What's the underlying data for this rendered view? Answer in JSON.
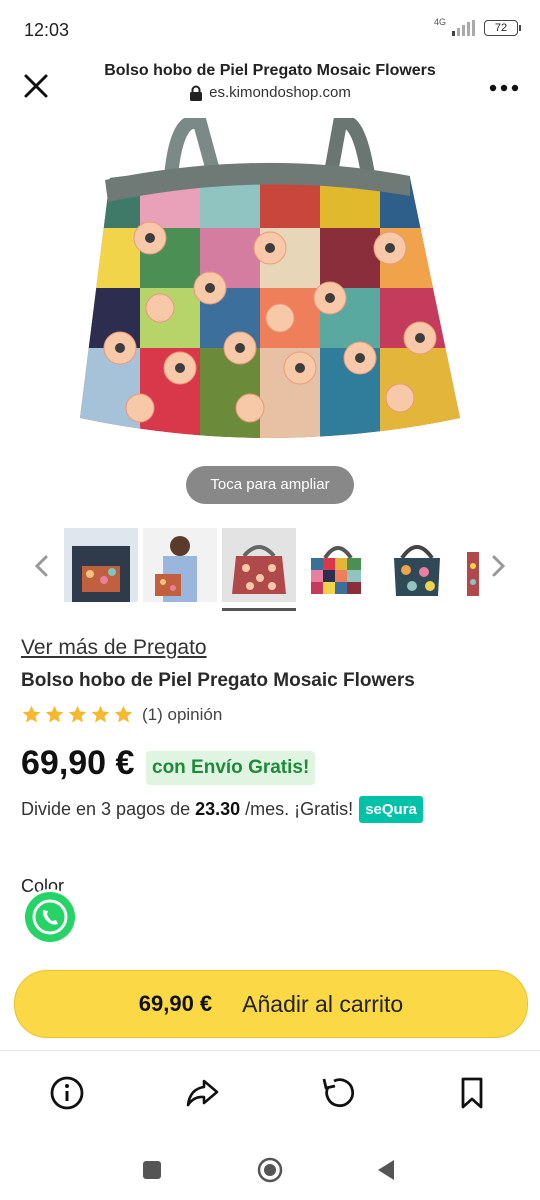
{
  "status": {
    "time": "12:03",
    "network": "4G",
    "battery": "72"
  },
  "topbar": {
    "title": "Bolso hobo de Piel Pregato Mosaic Flowers",
    "domain": "es.kimondoshop.com"
  },
  "hero": {
    "zoom_hint": "Toca para ampliar"
  },
  "product": {
    "brand_link": "Ver más de Pregato",
    "name": "Bolso hobo de Piel Pregato Mosaic Flowers",
    "rating_text": "(1) opinión",
    "rating_stars": 5,
    "price": "69,90 €",
    "free_shipping": "con Envío Gratis!",
    "installments_prefix": "Divide en 3 pagos de",
    "installments_amount": "23.30",
    "installments_suffix": "/mes. ¡Gratis!",
    "sequra_badge": "seQura",
    "color_label": "Color"
  },
  "cart": {
    "price": "69,90 €",
    "label": "Añadir al carrito"
  },
  "colors": {
    "cart_button": "#fbd946",
    "free_ship_text": "#1e8a3a",
    "sequra": "#00c2a8",
    "whatsapp": "#25d366"
  }
}
